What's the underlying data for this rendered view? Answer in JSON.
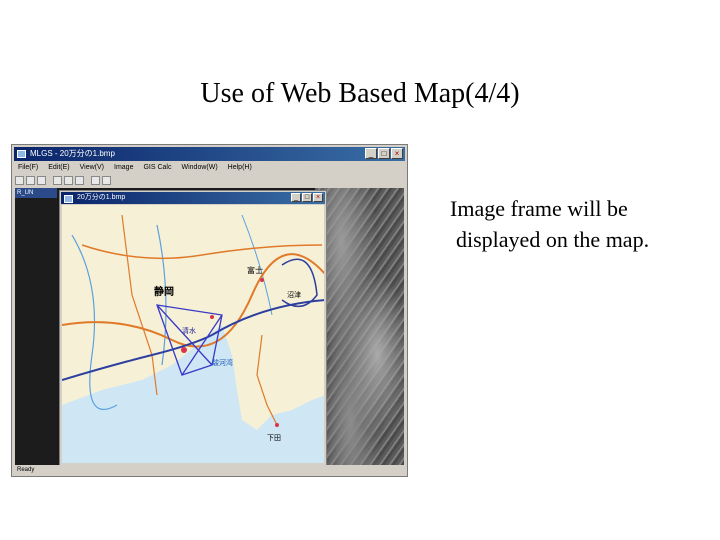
{
  "slide": {
    "title": "Use of Web Based Map(4/4)",
    "caption_line1": "Image frame will be",
    "caption_line2": "displayed on the map."
  },
  "app": {
    "title": "MLGS - 20万分の1.bmp",
    "menu": [
      "File(F)",
      "Edit(E)",
      "View(V)",
      "Image",
      "GIS Calc",
      "Window(W)",
      "Help(H)"
    ],
    "panel_header": "R_UN",
    "status": "Ready",
    "colors": {
      "titlebar": "#0a246a",
      "chrome": "#d4d0c8"
    }
  },
  "map_window": {
    "title": "20万分の1.bmp"
  },
  "map_labels": {
    "city_main": "静岡",
    "city_shimizu": "清水",
    "city_fuji": "富士",
    "city_numazu": "沼津",
    "bay": "駿河湾",
    "city_shimoda": "下田"
  }
}
